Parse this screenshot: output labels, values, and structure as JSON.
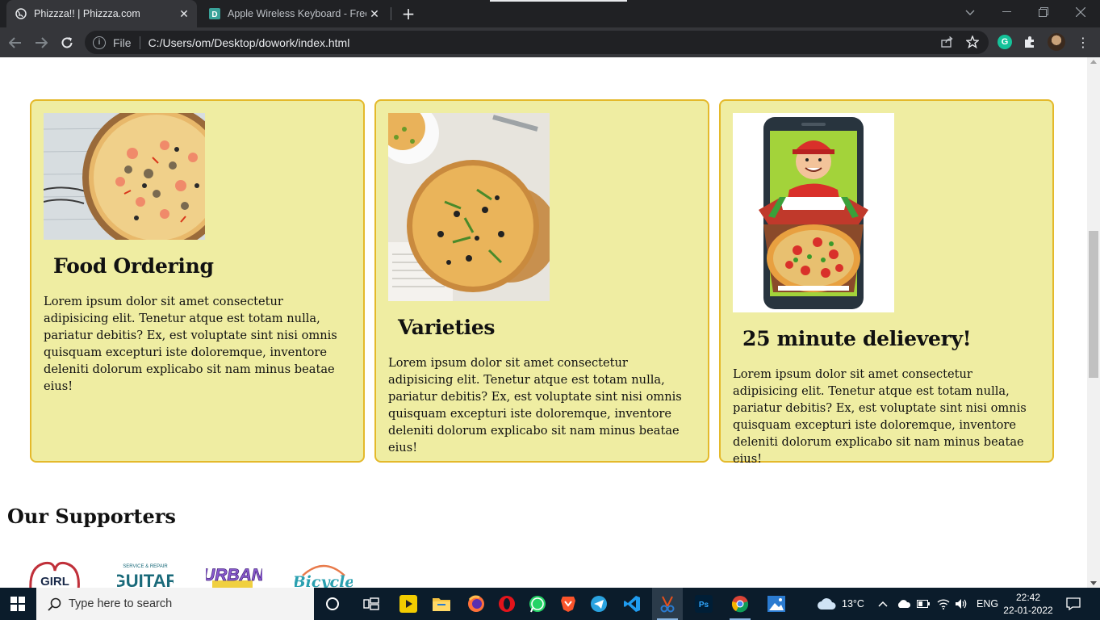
{
  "browser": {
    "tabs": [
      {
        "title": "Phizzza!! | Phizzza.com",
        "active": true
      },
      {
        "title": "Apple Wireless Keyboard - Free S",
        "active": false
      }
    ],
    "address": {
      "protocol_label": "File",
      "url": "C:/Users/om/Desktop/dowork/index.html"
    }
  },
  "page": {
    "cards": [
      {
        "title": "Food Ordering",
        "text": "Lorem ipsum dolor sit amet consectetur adipisicing elit. Tenetur atque est totam nulla, pariatur debitis? Ex, est voluptate sint nisi omnis quisquam excepturi iste doloremque, inventore deleniti dolorum explicabo sit nam minus beatae eius!",
        "image": "seafood-pizza-photo"
      },
      {
        "title": "Varieties",
        "text": "Lorem ipsum dolor sit amet consectetur adipisicing elit. Tenetur atque est totam nulla, pariatur debitis? Ex, est voluptate sint nisi omnis quisquam excepturi iste doloremque, inventore deleniti dolorum explicabo sit nam minus beatae eius!",
        "image": "sliced-pizza-photo"
      },
      {
        "title": "25 minute delievery!",
        "text": "Lorem ipsum dolor sit amet consectetur adipisicing elit. Tenetur atque est totam nulla, pariatur debitis? Ex, est voluptate sint nisi omnis quisquam excepturi iste doloremque, inventore deleniti dolorum explicabo sit nam minus beatae eius!",
        "image": "delivery-man-phone-illustration"
      }
    ],
    "supporters_title": "Our Supporters",
    "supporter_logos": [
      "GIRL",
      "GUITAR",
      "URBAN",
      "Bicycle"
    ],
    "colors": {
      "card_bg": "#efeda2",
      "card_border": "#e4b92b"
    }
  },
  "taskbar": {
    "search_placeholder": "Type here to search",
    "apps": [
      "task-view",
      "media-player",
      "file-explorer",
      "firefox",
      "opera",
      "whatsapp",
      "brave",
      "telegram",
      "vscode",
      "snipping-tool",
      "photoshop",
      "chrome",
      "photos"
    ],
    "weather": "13°C",
    "language": "ENG",
    "time": "22:42",
    "date": "22-01-2022"
  }
}
